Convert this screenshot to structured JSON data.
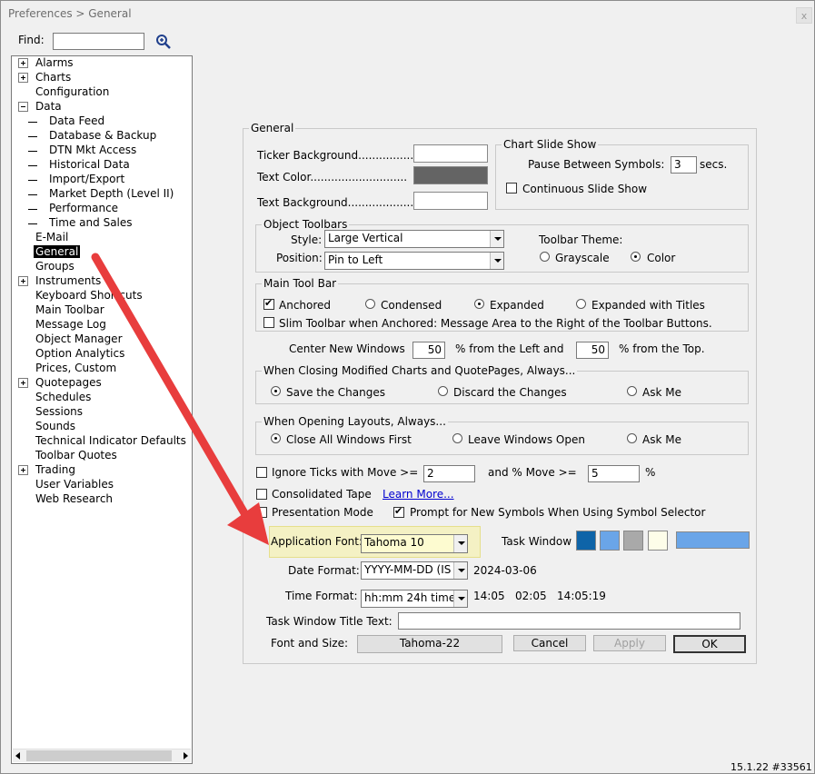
{
  "window": {
    "title": "Preferences > General",
    "close_label": "x",
    "version": "15.1.22 #33561"
  },
  "find": {
    "label": "Find:",
    "value": ""
  },
  "tree": {
    "alarms": "Alarms",
    "charts": "Charts",
    "configuration": "Configuration",
    "data": "Data",
    "data_feed": "Data Feed",
    "database_backup": "Database & Backup",
    "dtn_mkt_access": "DTN Mkt Access",
    "historical_data": "Historical Data",
    "import_export": "Import/Export",
    "market_depth": "Market Depth (Level II)",
    "performance": "Performance",
    "time_and_sales": "Time and Sales",
    "email": "E-Mail",
    "general": "General",
    "groups": "Groups",
    "instruments": "Instruments",
    "keyboard_shortcuts": "Keyboard Shortcuts",
    "main_toolbar": "Main Toolbar",
    "message_log": "Message Log",
    "object_manager": "Object Manager",
    "option_analytics": "Option Analytics",
    "prices_custom": "Prices, Custom",
    "quotepages": "Quotepages",
    "schedules": "Schedules",
    "sessions": "Sessions",
    "sounds": "Sounds",
    "technical_indicator_defaults": "Technical Indicator Defaults",
    "toolbar_quotes": "Toolbar Quotes",
    "trading": "Trading",
    "user_variables": "User Variables",
    "web_research": "Web Research"
  },
  "general": {
    "title": "General",
    "ticker_background": "Ticker Background................",
    "text_color": "Text Color............................",
    "text_background": "Text Background.....................",
    "colors": {
      "ticker_bg": "#ffffff",
      "text_color": "#646464",
      "text_bg": "#ffffff"
    }
  },
  "slideshow": {
    "title": "Chart Slide Show",
    "pause_label": "Pause Between Symbols:",
    "pause_value": "3",
    "secs_label": "secs.",
    "continuous_label": "Continuous Slide Show"
  },
  "object_toolbars": {
    "title": "Object Toolbars",
    "style_label": "Style:",
    "style_value": "Large Vertical",
    "position_label": "Position:",
    "position_value": "Pin to Left",
    "theme_label": "Toolbar Theme:",
    "grayscale_label": "Grayscale",
    "color_label": "Color"
  },
  "main_tool_bar": {
    "title": "Main Tool Bar",
    "anchored": "Anchored",
    "condensed": "Condensed",
    "expanded": "Expanded",
    "expanded_titles": "Expanded with Titles",
    "slim": "Slim Toolbar when Anchored: Message Area to the Right of the Toolbar Buttons."
  },
  "center_windows": {
    "label": "Center New Windows",
    "left_value": "50",
    "left_label": "% from the Left and",
    "top_value": "50",
    "top_label": "% from the Top."
  },
  "closing": {
    "title": "When Closing Modified Charts and QuotePages, Always...",
    "save": "Save the Changes",
    "discard": "Discard the Changes",
    "ask": "Ask Me"
  },
  "opening": {
    "title": "When Opening Layouts, Always...",
    "close_all": "Close All Windows First",
    "leave_open": "Leave Windows Open",
    "ask": "Ask Me"
  },
  "misc": {
    "ignore_ticks": "Ignore Ticks with Move >=",
    "ignore_value": "2",
    "pct_move_label": "and % Move >=",
    "pct_value": "5",
    "pct_symbol": "%",
    "consolidated_tape": "Consolidated Tape",
    "learn_more": "Learn More...",
    "presentation_mode": "Presentation Mode",
    "prompt_symbols": "Prompt for New Symbols When Using Symbol Selector"
  },
  "fonts": {
    "app_font_label": "Application Font:",
    "app_font_value": "Tahoma 10",
    "task_window_label": "Task Window",
    "task_colors": {
      "c1": "#0e64a8",
      "c2": "#6aa5e8",
      "c3": "#a9a9a9",
      "c4": "#fdfde9",
      "wide": "#6aa5e8"
    },
    "date_format_label": "Date Format:",
    "date_format_value": "YYYY-MM-DD (IS",
    "date_sample": "2024-03-06",
    "time_format_label": "Time Format:",
    "time_format_value": "hh:mm 24h time",
    "time_sample": "14:05   02:05   14:05:19",
    "title_text_label": "Task Window Title Text:",
    "title_text_value": "",
    "font_size_label": "Font and Size:",
    "font_size_value": "Tahoma-22",
    "cancel": "Cancel",
    "apply": "Apply",
    "ok": "OK"
  }
}
